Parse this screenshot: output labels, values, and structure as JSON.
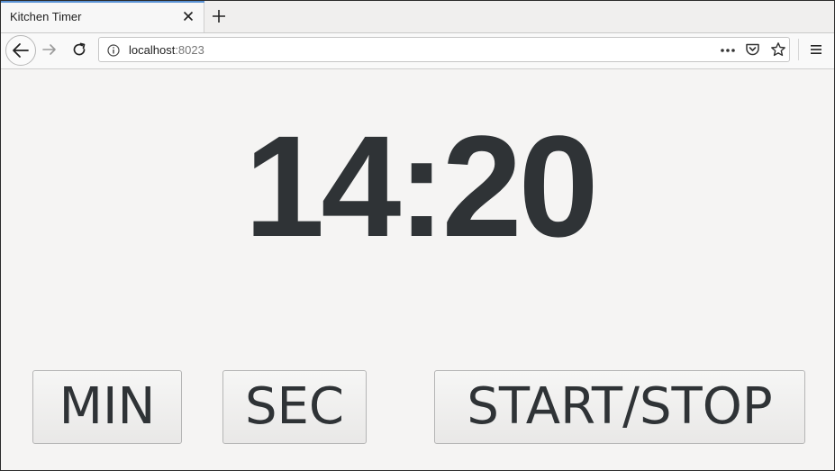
{
  "browser": {
    "tab_title": "Kitchen Timer",
    "url_host": "localhost",
    "url_port": ":8023",
    "icons": {
      "tab_close": "close-icon",
      "new_tab": "plus-icon",
      "back": "arrow-left-icon",
      "forward": "arrow-right-icon",
      "reload": "reload-icon",
      "site_info": "info-icon",
      "page_actions": "more-icon",
      "pocket": "pocket-icon",
      "bookmark": "star-icon",
      "menu": "hamburger-menu-icon"
    }
  },
  "timer": {
    "display": "14:20"
  },
  "controls": {
    "min_label": "MIN",
    "sec_label": "SEC",
    "start_stop_label": "START/STOP"
  },
  "colors": {
    "background": "#f5f4f3",
    "digits": "#2f3336",
    "tab_accent": "#5b93d6"
  }
}
